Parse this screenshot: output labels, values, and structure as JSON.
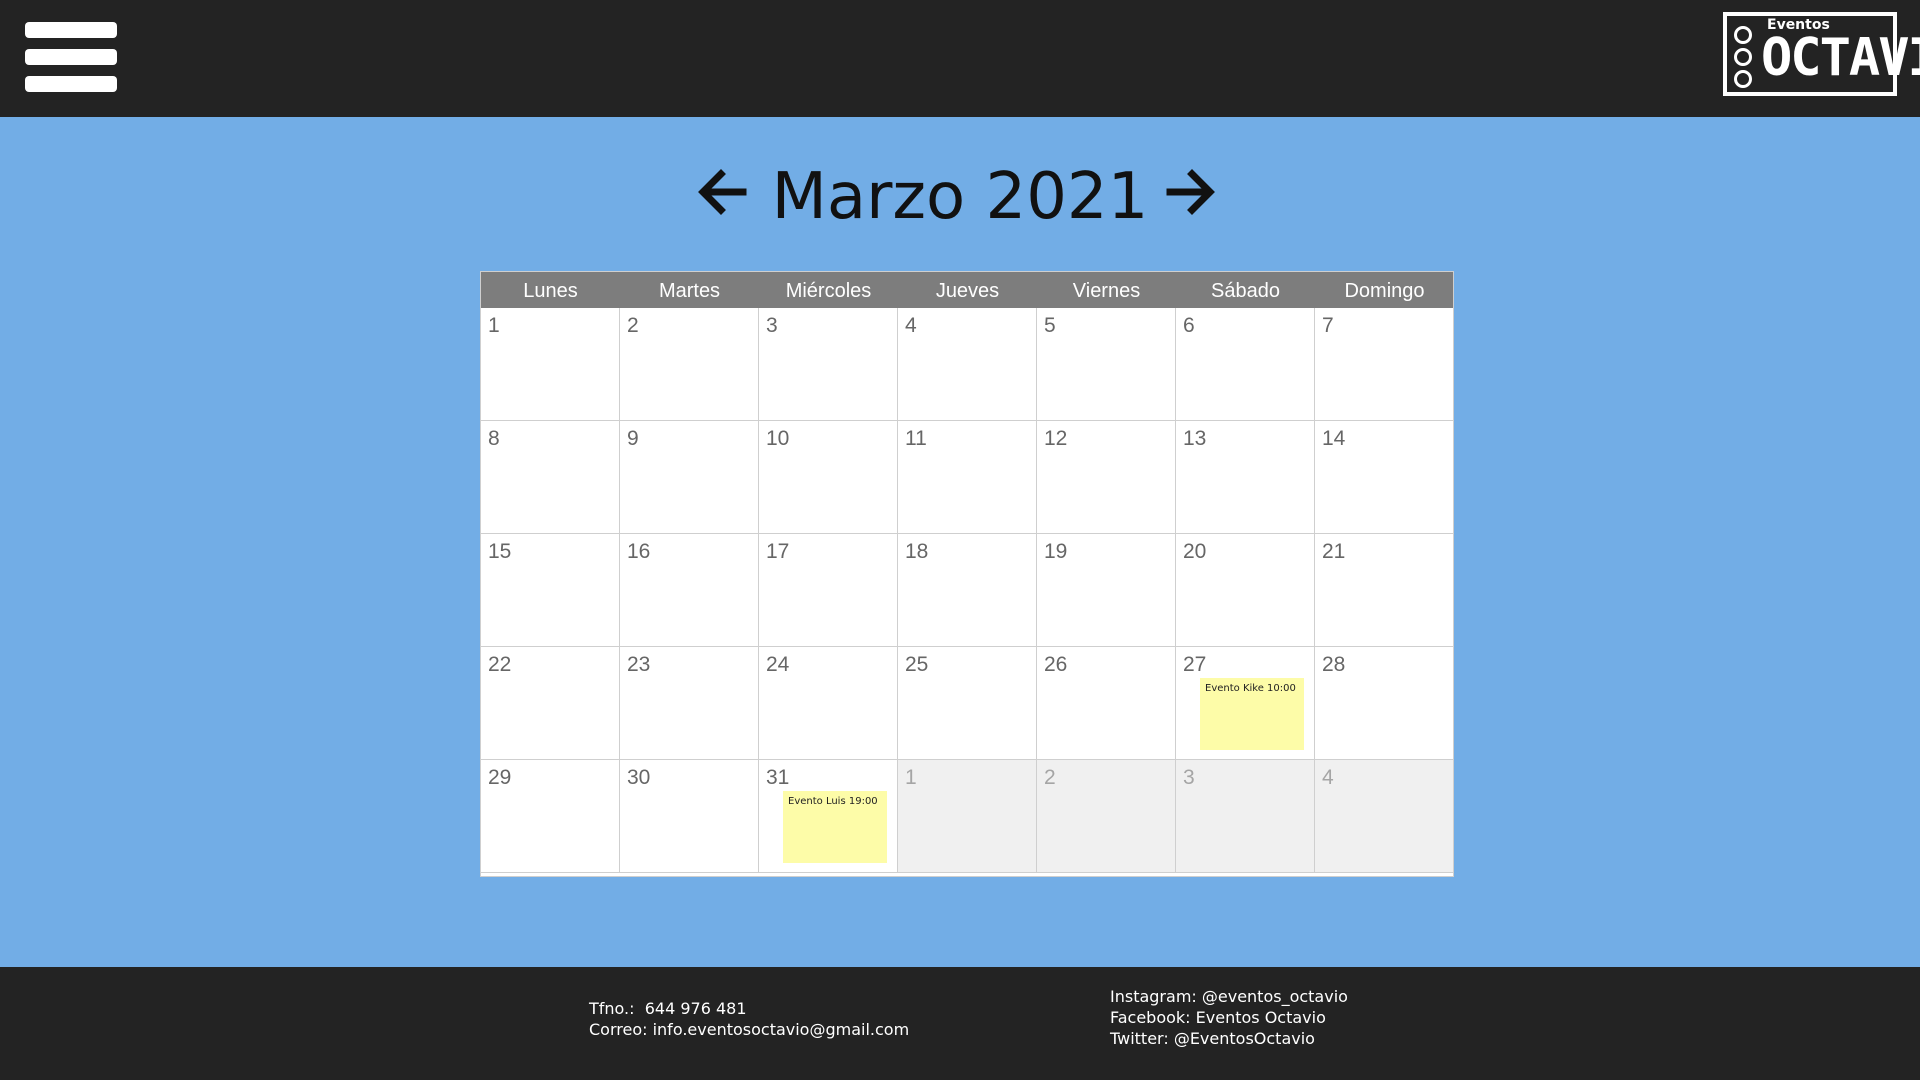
{
  "header": {
    "menu_icon": "hamburger-menu-icon",
    "logo": {
      "small_text": "Eventos",
      "big_text": "OCTAVIO"
    }
  },
  "calendar": {
    "title": "Marzo 2021",
    "prev_icon": "arrow-left-icon",
    "next_icon": "arrow-right-icon",
    "weekdays": [
      "Lunes",
      "Martes",
      "Miércoles",
      "Jueves",
      "Viernes",
      "Sábado",
      "Domingo"
    ],
    "weeks": [
      [
        {
          "day": "1"
        },
        {
          "day": "2"
        },
        {
          "day": "3"
        },
        {
          "day": "4"
        },
        {
          "day": "5"
        },
        {
          "day": "6"
        },
        {
          "day": "7"
        }
      ],
      [
        {
          "day": "8"
        },
        {
          "day": "9"
        },
        {
          "day": "10"
        },
        {
          "day": "11"
        },
        {
          "day": "12"
        },
        {
          "day": "13"
        },
        {
          "day": "14"
        }
      ],
      [
        {
          "day": "15"
        },
        {
          "day": "16"
        },
        {
          "day": "17"
        },
        {
          "day": "18"
        },
        {
          "day": "19"
        },
        {
          "day": "20"
        },
        {
          "day": "21"
        }
      ],
      [
        {
          "day": "22"
        },
        {
          "day": "23"
        },
        {
          "day": "24"
        },
        {
          "day": "25"
        },
        {
          "day": "26"
        },
        {
          "day": "27",
          "event": "Evento Kike 10:00"
        },
        {
          "day": "28"
        }
      ],
      [
        {
          "day": "29"
        },
        {
          "day": "30"
        },
        {
          "day": "31",
          "event": "Evento Luis 19:00"
        },
        {
          "day": "1",
          "other": true
        },
        {
          "day": "2",
          "other": true
        },
        {
          "day": "3",
          "other": true
        },
        {
          "day": "4",
          "other": true
        }
      ]
    ],
    "colors": {
      "background": "#72ade6",
      "header_bar": "#7d7d7d",
      "event_note": "#fdfca8",
      "other_month": "#f0f0f0"
    }
  },
  "footer": {
    "phone": "Tfno.:  644 976 481",
    "email": "Correo: info.eventosoctavio@gmail.com",
    "instagram": "Instagram: @eventos_octavio",
    "facebook": "Facebook: Eventos Octavio",
    "twitter": "Twitter: @EventosOctavio"
  }
}
